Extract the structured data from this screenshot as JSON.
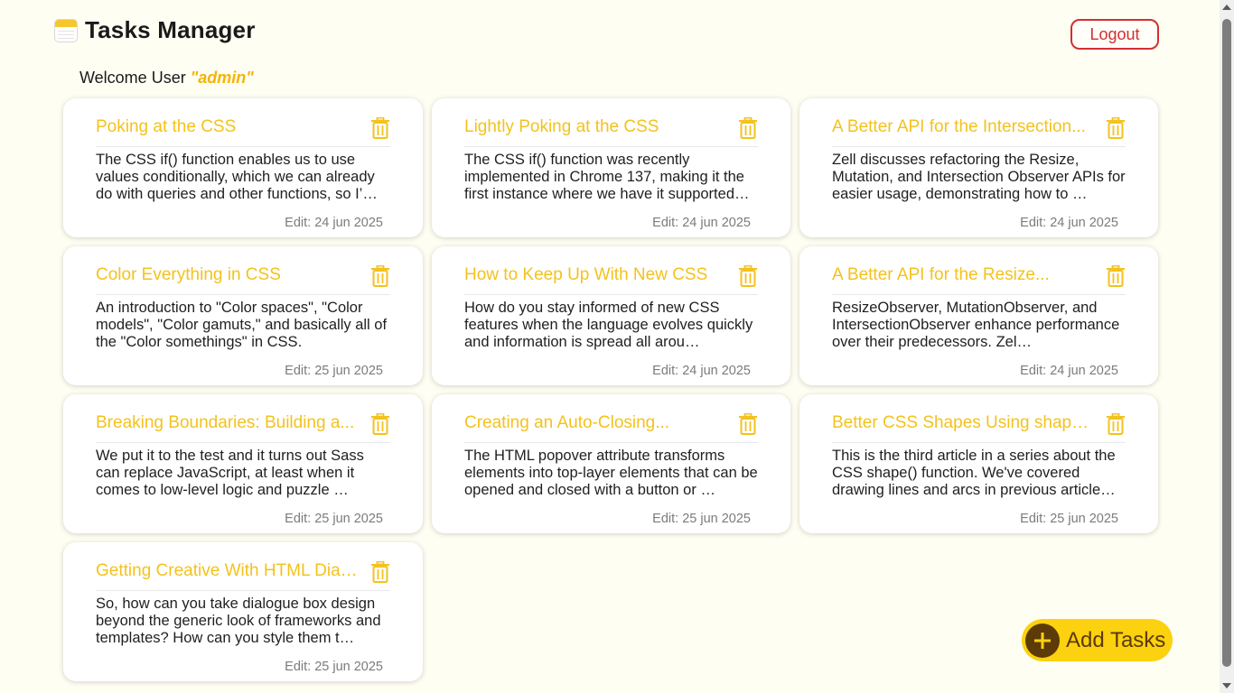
{
  "header": {
    "title": "Tasks Manager",
    "logout_label": "Logout"
  },
  "welcome": {
    "prefix": "Welcome User ",
    "username": "\"admin\""
  },
  "colors": {
    "accent": "#f4c21c",
    "add_button": "#fcd10f",
    "add_button_text": "#5c3b07",
    "logout": "#d32f2f"
  },
  "tasks": [
    {
      "title": "Poking at the CSS",
      "body": "  The CSS if() function enables us to use values conditionally, which we can already do with queries and other functions, so I’…",
      "date": "Edit: 24 jun 2025"
    },
    {
      "title": "Lightly Poking at the CSS",
      "body": "  The CSS if() function was recently implemented in Chrome 137, making it the first instance where we have it supported…",
      "date": "Edit: 24 jun 2025"
    },
    {
      "title": "A Better API for the Intersection...",
      "body": "  Zell discusses refactoring the Resize, Mutation, and Intersection Observer APIs for easier usage, demonstrating how to …",
      "date": "Edit: 24 jun 2025"
    },
    {
      "title": "Color Everything in CSS",
      "body": "  An introduction to \"Color spaces\", \"Color models\", \"Color gamuts,\" and basically all of the \"Color somethings\" in CSS.",
      "date": "Edit: 25 jun 2025"
    },
    {
      "title": "How to Keep Up With New CSS",
      "body": "  How do you stay informed of new CSS features when the language evolves quickly and information is spread all arou…",
      "date": "Edit: 24 jun 2025"
    },
    {
      "title": "A Better API for the Resize...",
      "body": "  ResizeObserver, MutationObserver, and IntersectionObserver enhance performance over their predecessors. Zel…",
      "date": "Edit: 24 jun 2025"
    },
    {
      "title": "Breaking Boundaries: Building a...",
      "body": "  We put it to the test and it turns out Sass can replace JavaScript, at least when it comes to low-level logic and puzzle …",
      "date": "Edit: 25 jun 2025"
    },
    {
      "title": "Creating an Auto-Closing...",
      "body": "  The HTML popover attribute transforms elements into top-layer elements that can be opened and closed with a button or …",
      "date": "Edit: 25 jun 2025"
    },
    {
      "title": "Better CSS Shapes Using shape(...",
      "body": "  This is the third article in a series about the CSS shape() function. We've covered drawing lines and arcs in previous article…",
      "date": "Edit: 25 jun 2025"
    },
    {
      "title": "Getting Creative With HTML Dialog",
      "body": "  So, how can you take dialogue box design beyond the generic look of frameworks and templates? How can you style them t…",
      "date": "Edit: 25 jun 2025"
    }
  ],
  "add_tasks": {
    "label": "Add Tasks",
    "icon": "plus-icon"
  },
  "icons": {
    "app": "notes-icon",
    "delete": "trash-icon"
  }
}
